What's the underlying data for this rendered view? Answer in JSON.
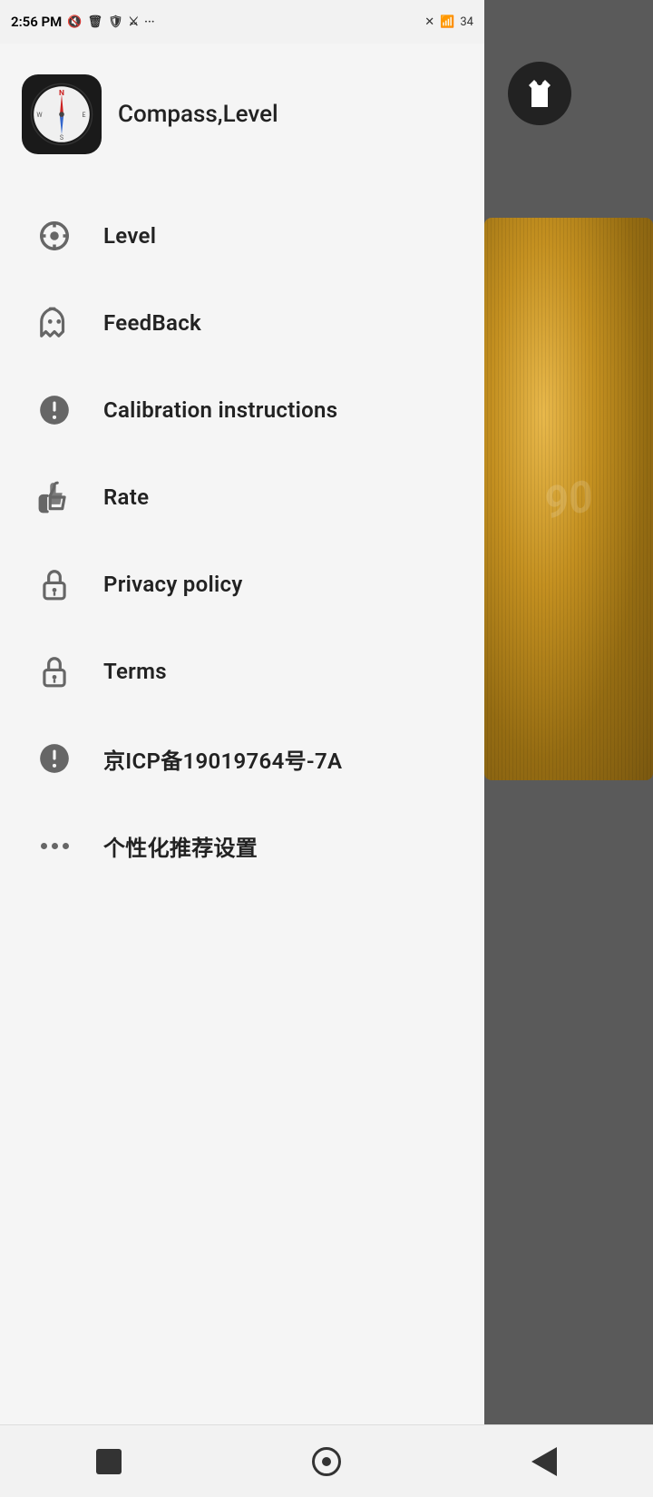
{
  "statusBar": {
    "time": "2:56 PM",
    "batteryLevel": "34"
  },
  "app": {
    "title": "Compass,Level"
  },
  "menu": {
    "items": [
      {
        "id": "level",
        "label": "Level",
        "icon": "crosshair"
      },
      {
        "id": "feedback",
        "label": "FeedBack",
        "icon": "ghost"
      },
      {
        "id": "calibration",
        "label": "Calibration instructions",
        "icon": "exclamation"
      },
      {
        "id": "rate",
        "label": "Rate",
        "icon": "thumbsup"
      },
      {
        "id": "privacy",
        "label": "Privacy policy",
        "icon": "lock"
      },
      {
        "id": "terms",
        "label": "Terms",
        "icon": "lock"
      },
      {
        "id": "icp",
        "label": "京ICP备19019764号-7A",
        "icon": "exclamation"
      },
      {
        "id": "personalized",
        "label": "个性化推荐设置",
        "icon": "dots"
      }
    ]
  },
  "navbar": {
    "back": "back",
    "home": "home",
    "recents": "recents"
  }
}
